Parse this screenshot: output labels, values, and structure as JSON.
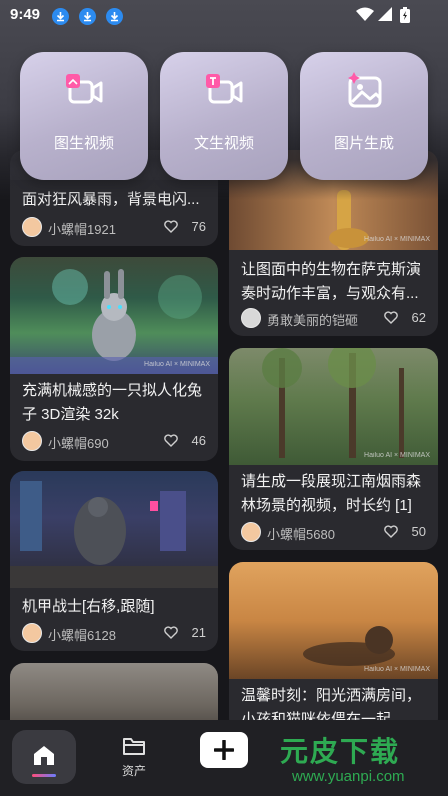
{
  "status_bar": {
    "time": "9:49"
  },
  "actions": [
    {
      "label": "图生视频",
      "icon": "image-to-video-icon"
    },
    {
      "label": "文生视频",
      "icon": "text-to-video-icon"
    },
    {
      "label": "图片生成",
      "icon": "image-generate-icon"
    }
  ],
  "feed": {
    "left": [
      {
        "title": "面对狂风暴雨，背景电闪...",
        "author": "小螺帽1921",
        "likes": "76"
      },
      {
        "title": "充满机械感的一只拟人化兔子 3D渲染 32k",
        "author": "小螺帽690",
        "likes": "46"
      },
      {
        "title": "机甲战士[右移,跟随]",
        "author": "小螺帽6128",
        "likes": "21"
      }
    ],
    "right": [
      {
        "title": "让图面中的生物在萨克斯演奏时动作丰富，与观众有...",
        "author": "勇敢美丽的铠砸",
        "likes": "62"
      },
      {
        "title": "请生成一段展现江南烟雨森林场景的视频，时长约 [1] ...",
        "author": "小螺帽5680",
        "likes": "50"
      },
      {
        "title": "温馨时刻：阳光洒满房间，小孩和猫咪依偎在一起",
        "author": "",
        "likes": ""
      }
    ],
    "watermark_text": "Hailuo AI × MINIMAX"
  },
  "bottom_nav": {
    "home_icon": "home-icon",
    "assets_label": "资产",
    "plus_icon": "plus-icon"
  },
  "site_watermark": {
    "title": "元皮下载",
    "url": "www.yuanpi.com"
  },
  "colors": {
    "accent": "#2c8bf0",
    "card_bg": "#2a2a2f",
    "background": "#17171b"
  }
}
